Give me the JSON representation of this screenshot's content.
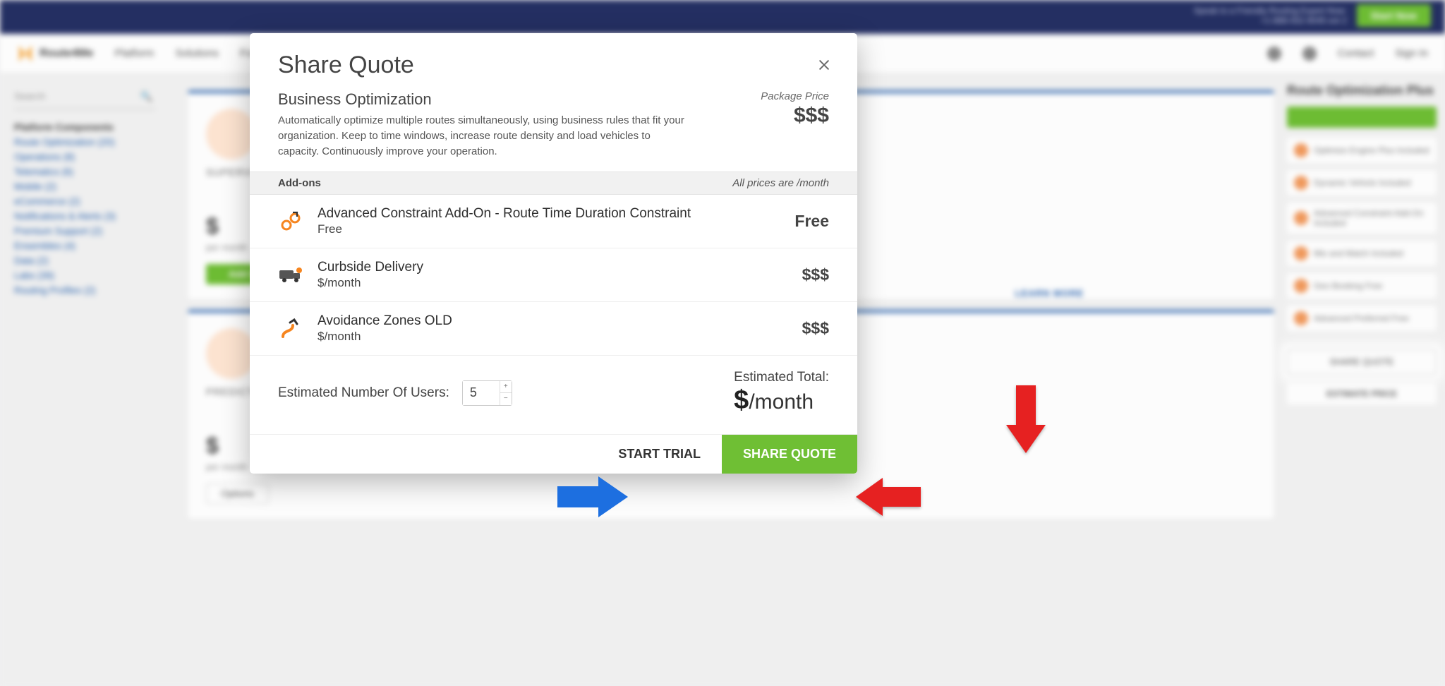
{
  "modal": {
    "title": "Share Quote",
    "plan_name": "Business Optimization",
    "plan_desc": "Automatically optimize multiple routes simultaneously, using business rules that fit your organization. Keep to time windows, increase route density and load vehicles to capacity. Continuously improve your operation.",
    "package_price_label": "Package Price",
    "package_price_value": "$$$",
    "addons_header_left": "Add-ons",
    "addons_header_right": "All prices are /month",
    "addons": [
      {
        "title": "Advanced Constraint Add-On - Route Time Duration Constraint",
        "subprice": "Free",
        "price": "Free"
      },
      {
        "title": "Curbside Delivery",
        "subprice": "$/month",
        "price": "$$$"
      },
      {
        "title": "Avoidance Zones OLD",
        "subprice": "$/month",
        "price": "$$$"
      }
    ],
    "users_label": "Estimated Number Of Users:",
    "users_value": "5",
    "total_label": "Estimated Total:",
    "total_value": "$",
    "total_unit": "/month",
    "start_trial": "START TRIAL",
    "share_quote": "SHARE QUOTE"
  },
  "bg": {
    "topbar_line1": "Speak to a Friendly Routing Expert Now:",
    "topbar_line2": "+1-888-552-9045 ext 2",
    "topbar_cta": "Start Now",
    "brand": "Route4Me",
    "nav": [
      "Platform",
      "Solutions",
      "For Developers"
    ],
    "nav_right": [
      "Contact",
      "Sign In"
    ],
    "search_placeholder": "Search",
    "cats": [
      "Platform Components",
      "Route Optimization (20)",
      "Operations (8)",
      "Telematics (6)",
      "Mobile (2)",
      "eCommerce (2)",
      "Notifications & Alerts (3)",
      "Premium Support (2)",
      "Ensembles (4)",
      "Data (2)",
      "Labs (39)",
      "Routing Profiles (2)"
    ],
    "card1_label": "SUPERVISOR",
    "card1_price": "$",
    "card1_sub": "per month",
    "card1_btn": "Add to Cart",
    "card1_learn": "LEARN MORE",
    "card2_label": "PREDICTIVE",
    "card2_price": "$",
    "card2_sub": "per month",
    "card2_dd": "Options",
    "right_title": "Route Optimization Plus",
    "right_items": [
      "Optimize Engine Plus  Included",
      "Dynamic Vehicle  Included",
      "Advanced Constraint Add-On  Included",
      "Mix and Match  Included",
      "Geo Booking  Free",
      "Advanced Preferred  Free"
    ],
    "right_share": "SHARE QUOTE",
    "right_estimate": "ESTIMATE PRICE"
  }
}
